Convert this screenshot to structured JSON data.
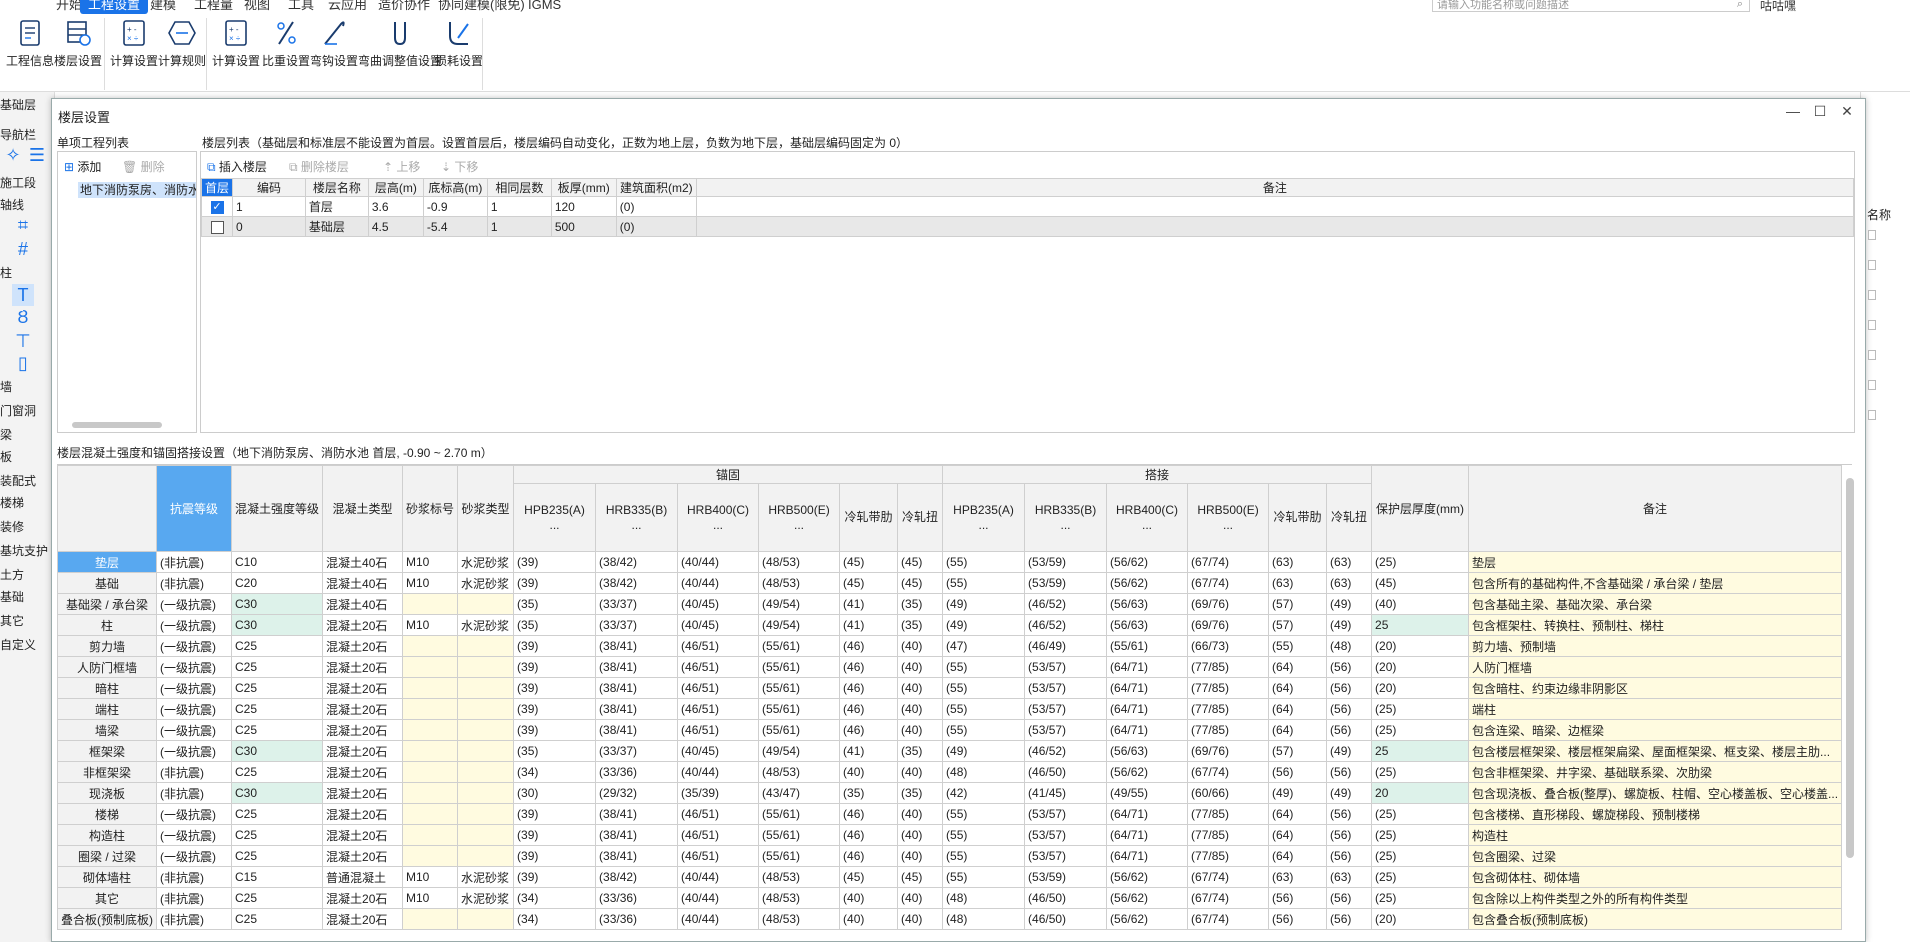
{
  "menu": {
    "tabs": [
      "开始",
      "工程设置",
      "建模",
      "工程量",
      "视图",
      "工具",
      "云应用",
      "造价协作",
      "协同建模(限免)",
      "IGMS"
    ],
    "active": 1,
    "search_placeholder": "请输入功能名称或问题描述",
    "user": "咕咕嘿"
  },
  "ribbon": {
    "groups": [
      {
        "buttons": [
          {
            "label": "工程信息",
            "icon": "document-icon"
          },
          {
            "label": "楼层设置",
            "icon": "floor-settings-icon"
          }
        ]
      },
      {
        "buttons": [
          {
            "label": "计算设置",
            "icon": "calculator-icon"
          },
          {
            "label": "计算规则",
            "icon": "rules-icon"
          }
        ]
      },
      {
        "buttons": [
          {
            "label": "计算设置",
            "icon": "calculator-icon"
          },
          {
            "label": "比重设置",
            "icon": "weight-icon"
          },
          {
            "label": "弯钩设置",
            "icon": "hook-icon"
          },
          {
            "label": "弯曲调整值设置",
            "icon": "bend-icon"
          },
          {
            "label": "损耗设置",
            "icon": "loss-icon"
          }
        ]
      }
    ]
  },
  "left_panel": {
    "items": [
      "基础层",
      "导航栏",
      "施工段",
      "轴线",
      "柱",
      "墙",
      "门窗洞",
      "梁",
      "板",
      "装配式",
      "楼梯",
      "装修",
      "基坑支护",
      "土方",
      "基础",
      "其它",
      "自定义"
    ]
  },
  "right_panel": {
    "header": "名称"
  },
  "dialog": {
    "title": "楼层设置",
    "project_list_label": "单项工程列表",
    "floor_list_label": "楼层列表（基础层和标准层不能设置为首层。设置首层后，楼层编码自动变化，正数为地上层，负数为地下层，基础层编码固定为 0）",
    "add_label": "添加",
    "delete_label": "删除",
    "project_item": "地下消防泵房、消防水池",
    "floor_toolbar": {
      "insert": "插入楼层",
      "delete": "删除楼层",
      "up": "上移",
      "down": "下移"
    },
    "floor_headers": [
      "首层",
      "编码",
      "楼层名称",
      "层高(m)",
      "底标高(m)",
      "相同层数",
      "板厚(mm)",
      "建筑面积(m2)",
      "备注"
    ],
    "floor_rows": [
      {
        "checked": true,
        "cells": [
          "1",
          "首层",
          "3.6",
          "-0.9",
          "1",
          "120",
          "(0)",
          ""
        ]
      },
      {
        "checked": false,
        "cells": [
          "0",
          "基础层",
          "4.5",
          "-5.4",
          "1",
          "500",
          "(0)",
          ""
        ]
      }
    ],
    "concrete_label": "楼层混凝土强度和锚固搭接设置（地下消防泵房、消防水池 首层, -0.90 ~ 2.70 m）",
    "concrete_group_headers": {
      "anchor": "锚固",
      "lap": "搭接"
    },
    "concrete_headers": [
      "",
      "抗震等级",
      "混凝土强度等级",
      "混凝土类型",
      "砂浆标号",
      "砂浆类型",
      "HPB235(A)\n...",
      "HRB335(B)\n...",
      "HRB400(C)\n...",
      "HRB500(E)\n...",
      "冷轧带肋",
      "冷轧扭",
      "HPB235(A)\n...",
      "HRB335(B)\n...",
      "HRB400(C)\n...",
      "HRB500(E)\n...",
      "冷轧带肋",
      "冷轧扭",
      "保护层厚度(mm)",
      "备注"
    ],
    "concrete_rows": [
      [
        "垫层",
        "(非抗震)",
        "C10",
        "混凝土40石",
        "M10",
        "水泥砂浆",
        "(39)",
        "(38/42)",
        "(40/44)",
        "(48/53)",
        "(45)",
        "(45)",
        "(55)",
        "(53/59)",
        "(56/62)",
        "(67/74)",
        "(63)",
        "(63)",
        "(25)",
        "垫层"
      ],
      [
        "基础",
        "(非抗震)",
        "C20",
        "混凝土40石",
        "M10",
        "水泥砂浆",
        "(39)",
        "(38/42)",
        "(40/44)",
        "(48/53)",
        "(45)",
        "(45)",
        "(55)",
        "(53/59)",
        "(56/62)",
        "(67/74)",
        "(63)",
        "(63)",
        "(45)",
        "包含所有的基础构件,不含基础梁 / 承台梁 / 垫层"
      ],
      [
        "基础梁 / 承台梁",
        "(一级抗震)",
        "C30",
        "混凝土40石",
        "",
        "",
        "(35)",
        "(33/37)",
        "(40/45)",
        "(49/54)",
        "(41)",
        "(35)",
        "(49)",
        "(46/52)",
        "(56/63)",
        "(69/76)",
        "(57)",
        "(49)",
        "(40)",
        "包含基础主梁、基础次梁、承台梁"
      ],
      [
        "柱",
        "(一级抗震)",
        "C30",
        "混凝土20石",
        "M10",
        "水泥砂浆",
        "(35)",
        "(33/37)",
        "(40/45)",
        "(49/54)",
        "(41)",
        "(35)",
        "(49)",
        "(46/52)",
        "(56/63)",
        "(69/76)",
        "(57)",
        "(49)",
        "25",
        "包含框架柱、转换柱、预制柱、梯柱"
      ],
      [
        "剪力墙",
        "(一级抗震)",
        "C25",
        "混凝土20石",
        "",
        "",
        "(39)",
        "(38/41)",
        "(46/51)",
        "(55/61)",
        "(46)",
        "(40)",
        "(47)",
        "(46/49)",
        "(55/61)",
        "(66/73)",
        "(55)",
        "(48)",
        "(20)",
        "剪力墙、预制墙"
      ],
      [
        "人防门框墙",
        "(一级抗震)",
        "C25",
        "混凝土20石",
        "",
        "",
        "(39)",
        "(38/41)",
        "(46/51)",
        "(55/61)",
        "(46)",
        "(40)",
        "(55)",
        "(53/57)",
        "(64/71)",
        "(77/85)",
        "(64)",
        "(56)",
        "(20)",
        "人防门框墙"
      ],
      [
        "暗柱",
        "(一级抗震)",
        "C25",
        "混凝土20石",
        "",
        "",
        "(39)",
        "(38/41)",
        "(46/51)",
        "(55/61)",
        "(46)",
        "(40)",
        "(55)",
        "(53/57)",
        "(64/71)",
        "(77/85)",
        "(64)",
        "(56)",
        "(20)",
        "包含暗柱、约束边缘非阴影区"
      ],
      [
        "端柱",
        "(一级抗震)",
        "C25",
        "混凝土20石",
        "",
        "",
        "(39)",
        "(38/41)",
        "(46/51)",
        "(55/61)",
        "(46)",
        "(40)",
        "(55)",
        "(53/57)",
        "(64/71)",
        "(77/85)",
        "(64)",
        "(56)",
        "(25)",
        "端柱"
      ],
      [
        "墙梁",
        "(一级抗震)",
        "C25",
        "混凝土20石",
        "",
        "",
        "(39)",
        "(38/41)",
        "(46/51)",
        "(55/61)",
        "(46)",
        "(40)",
        "(55)",
        "(53/57)",
        "(64/71)",
        "(77/85)",
        "(64)",
        "(56)",
        "(25)",
        "包含连梁、暗梁、边框梁"
      ],
      [
        "框架梁",
        "(一级抗震)",
        "C30",
        "混凝土20石",
        "",
        "",
        "(35)",
        "(33/37)",
        "(40/45)",
        "(49/54)",
        "(41)",
        "(35)",
        "(49)",
        "(46/52)",
        "(56/63)",
        "(69/76)",
        "(57)",
        "(49)",
        "25",
        "包含楼层框架梁、楼层框架扁梁、屋面框架梁、框支梁、楼层主肋..."
      ],
      [
        "非框架梁",
        "(非抗震)",
        "C25",
        "混凝土20石",
        "",
        "",
        "(34)",
        "(33/36)",
        "(40/44)",
        "(48/53)",
        "(40)",
        "(40)",
        "(48)",
        "(46/50)",
        "(56/62)",
        "(67/74)",
        "(56)",
        "(56)",
        "(25)",
        "包含非框架梁、井字梁、基础联系梁、次肋梁"
      ],
      [
        "现浇板",
        "(非抗震)",
        "C30",
        "混凝土20石",
        "",
        "",
        "(30)",
        "(29/32)",
        "(35/39)",
        "(43/47)",
        "(35)",
        "(35)",
        "(42)",
        "(41/45)",
        "(49/55)",
        "(60/66)",
        "(49)",
        "(49)",
        "20",
        "包含现浇板、叠合板(整厚)、螺旋板、柱帽、空心楼盖板、空心楼盖..."
      ],
      [
        "楼梯",
        "(一级抗震)",
        "C25",
        "混凝土20石",
        "",
        "",
        "(39)",
        "(38/41)",
        "(46/51)",
        "(55/61)",
        "(46)",
        "(40)",
        "(55)",
        "(53/57)",
        "(64/71)",
        "(77/85)",
        "(64)",
        "(56)",
        "(25)",
        "包含楼梯、直形梯段、螺旋梯段、预制楼梯"
      ],
      [
        "构造柱",
        "(一级抗震)",
        "C25",
        "混凝土20石",
        "",
        "",
        "(39)",
        "(38/41)",
        "(46/51)",
        "(55/61)",
        "(46)",
        "(40)",
        "(55)",
        "(53/57)",
        "(64/71)",
        "(77/85)",
        "(64)",
        "(56)",
        "(25)",
        "构造柱"
      ],
      [
        "圈梁 / 过梁",
        "(一级抗震)",
        "C25",
        "混凝土20石",
        "",
        "",
        "(39)",
        "(38/41)",
        "(46/51)",
        "(55/61)",
        "(46)",
        "(40)",
        "(55)",
        "(53/57)",
        "(64/71)",
        "(77/85)",
        "(64)",
        "(56)",
        "(25)",
        "包含圈梁、过梁"
      ],
      [
        "砌体墙柱",
        "(非抗震)",
        "C15",
        "普通混凝土",
        "M10",
        "水泥砂浆",
        "(39)",
        "(38/42)",
        "(40/44)",
        "(48/53)",
        "(45)",
        "(45)",
        "(55)",
        "(53/59)",
        "(56/62)",
        "(67/74)",
        "(63)",
        "(63)",
        "(25)",
        "包含砌体柱、砌体墙"
      ],
      [
        "其它",
        "(非抗震)",
        "C25",
        "混凝土20石",
        "M10",
        "水泥砂浆",
        "(34)",
        "(33/36)",
        "(40/44)",
        "(48/53)",
        "(40)",
        "(40)",
        "(48)",
        "(46/50)",
        "(56/62)",
        "(67/74)",
        "(56)",
        "(56)",
        "(25)",
        "包含除以上构件类型之外的所有构件类型"
      ],
      [
        "叠合板(预制底板)",
        "(非抗震)",
        "C25",
        "混凝土20石",
        "",
        "",
        "(34)",
        "(33/36)",
        "(40/44)",
        "(48/53)",
        "(40)",
        "(40)",
        "(48)",
        "(46/50)",
        "(56/62)",
        "(67/74)",
        "(56)",
        "(56)",
        "(20)",
        "包含叠合板(预制底板)"
      ]
    ],
    "highlight_strength": [
      2,
      3,
      9,
      11
    ],
    "highlight_cover": [
      3,
      9,
      11
    ]
  }
}
